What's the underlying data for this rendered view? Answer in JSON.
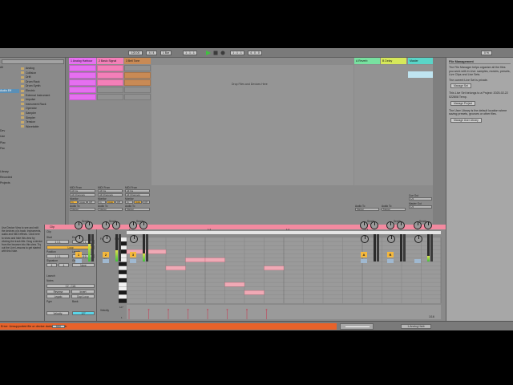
{
  "colors": {
    "accent_orange": "#f5b83d",
    "track1": "#e66ff0",
    "track2": "#f47fb8",
    "track3": "#c98a55",
    "return_a": "#78e1a0",
    "return_b": "#d6e85a",
    "master": "#5ad5c8",
    "clip_title": "#f38aa0",
    "status_error": "#e7622a",
    "selection": "#5a8fb6"
  },
  "browser": {
    "search_placeholder": "",
    "categories": [
      "All",
      "",
      "",
      "",
      "Audio Eff",
      "",
      "",
      "",
      "",
      "",
      "",
      "Dev",
      "Use",
      "Plac",
      "Pac",
      "",
      "",
      "",
      "Library",
      "Recorded",
      "Projects"
    ],
    "items": [
      "Analog",
      "Collision",
      "Drift",
      "Drum Rack",
      "Drum Synth",
      "Electric",
      "External Instrument",
      "Impulse",
      "Instrument Rack",
      "Operator",
      "Sampler",
      "Simpler",
      "Tension",
      "Wavetable"
    ]
  },
  "tracks": [
    {
      "name": "1 Analog Harbour",
      "input_label": "MIDI From",
      "input": "All Ins",
      "channel": "All Channels",
      "monitor": "Monitor",
      "monitor_in": "In",
      "monitor_auto": "Auto",
      "monitor_off": "Off",
      "out_label": "Audio To",
      "output": "Master",
      "sends_label": "Sends",
      "number": "1",
      "color_key": "track1"
    },
    {
      "name": "2 Basic Signal",
      "input_label": "MIDI From",
      "input": "All Ins",
      "channel": "All Channels",
      "monitor": "Monitor",
      "monitor_in": "In",
      "monitor_auto": "Auto",
      "monitor_off": "Off",
      "out_label": "Audio To",
      "output": "Master",
      "sends_label": "Sends",
      "number": "2",
      "color_key": "track2"
    },
    {
      "name": "3 Bell Tone",
      "input_label": "MIDI From",
      "input": "All Ins",
      "channel": "All Channels",
      "monitor": "Monitor",
      "monitor_in": "In",
      "monitor_auto": "Auto",
      "monitor_off": "Off",
      "out_label": "Audio To",
      "output": "Master",
      "sends_label": "Sends",
      "number": "3",
      "color_key": "track3"
    }
  ],
  "returns": [
    {
      "name": "A Reverb",
      "out_label": "Audio To",
      "output": "Master",
      "sends_label": "Sends",
      "letter": "A"
    },
    {
      "name": "B Delay",
      "out_label": "Audio To",
      "output": "Master",
      "sends_label": "Sends",
      "letter": "B"
    }
  ],
  "master": {
    "name": "Master",
    "cue_label": "Cue Out",
    "cue": "1/2",
    "out_label": "Master Out",
    "output": "1/2",
    "sends_label": "Sends"
  },
  "session": {
    "drop_text": "Drop Files and Devices Here"
  },
  "transport": {
    "tempo": "120.00",
    "signature": "4 / 4",
    "quantize": "1 Bar",
    "position": "1 . 1 . 1",
    "loop_start": "1 . 1 . 1",
    "loop_len": "4 . 0 . 0",
    "cpu": "0 %"
  },
  "info_view": {
    "title": "File Management",
    "para1": "The File Manager helps organize all the files you work with in Live: samples, movies, presets, Live Clips and Live Sets.",
    "para2": "The current Live Set is private.",
    "button1": "Manage Set",
    "para3": "This Live Set belongs to a Project: 2025-02-22 022808 Temp.",
    "button2": "Manage Project",
    "para4": "The User Library is the default location where saving presets, grooves or other files.",
    "button3": "Manage User Library"
  },
  "help_view": {
    "text": "Use Device View to see and edit the devices of a track: instruments, audio and MIDI effects. Click here to show and hide this view by clicking the track title. Drag a device from the browser into this view. Try out the Live Lessons to get started with this Note."
  },
  "clip_view": {
    "title": "Clip",
    "start_label": "Start",
    "end_label": "End",
    "start": "1 1 1",
    "end": "2 1 1",
    "loop": "Loop",
    "position_label": "Position",
    "length_label": "Length",
    "position": "1 1 1",
    "length": "1 0 0",
    "signature_label": "Signature",
    "groove_label": "Groove",
    "sig_num": "4",
    "sig_den": "4",
    "groove": "None",
    "launch": "Launch",
    "notes": "Notes",
    "note_range": "C2 - C#4",
    "rev": "Reverse",
    "inv": "Invert",
    "legato": "Legato",
    "dupl": "Dupl.Loop",
    "pgm": "Pgm",
    "bank": "Bank",
    "velocity_label": "Velocity",
    "zoom_label": "Fold",
    "scale_label": "Scale"
  },
  "midi_editor": {
    "fold": "Fold",
    "scale": "Scale",
    "c3_label": "C3",
    "ruler": [
      "1",
      "1.1.2",
      "1.1.3",
      "1.1.4",
      "1.2",
      "1.2.2",
      "1.2.3",
      "1.2.4",
      "1.3",
      "1.3.2",
      "1.3.3",
      "1.3.4",
      "1.4",
      "1.4.2",
      "1.4.3",
      "1.4.4"
    ],
    "page": "1/16",
    "velocity_label": "Velocity",
    "velocity_max": "127",
    "velocity_min": "1"
  },
  "status": {
    "message": "Error: Unsupported file or device during playback",
    "button": "MIDI",
    "track_name": "1-Analog Harb"
  }
}
